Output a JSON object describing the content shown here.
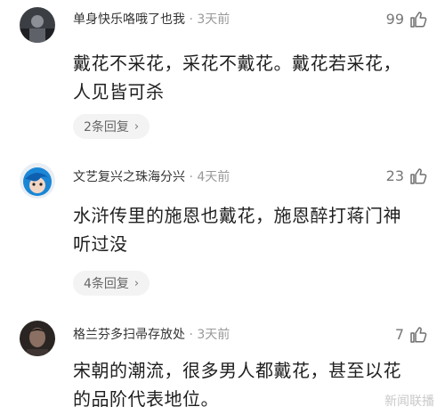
{
  "comments": [
    {
      "username": "单身快乐咯哦了也我",
      "time": "3天前",
      "likes": "99",
      "content_lines": [
        "戴花不采花，采花不戴花。戴花若采花，",
        "人见皆可杀"
      ],
      "replies_label": "2条回复",
      "avatar_icon": "avatar-photo-icon"
    },
    {
      "username": "文艺复兴之珠海分兴",
      "time": "4天前",
      "likes": "23",
      "content_lines": [
        "水浒传里的施恩也戴花，施恩醉打蒋门神",
        "听过没"
      ],
      "replies_label": "4条回复",
      "avatar_icon": "avatar-cartoon-icon"
    },
    {
      "username": "格兰芬多扫帚存放处",
      "time": "3天前",
      "likes": "7",
      "content_lines": [
        "宋朝的潮流，很多男人都戴花，甚至以花",
        "的品阶代表地位。"
      ],
      "avatar_icon": "avatar-portrait-icon"
    }
  ],
  "meta_separator": "·",
  "reply_chevron": "›",
  "watermark": "新闻联播"
}
